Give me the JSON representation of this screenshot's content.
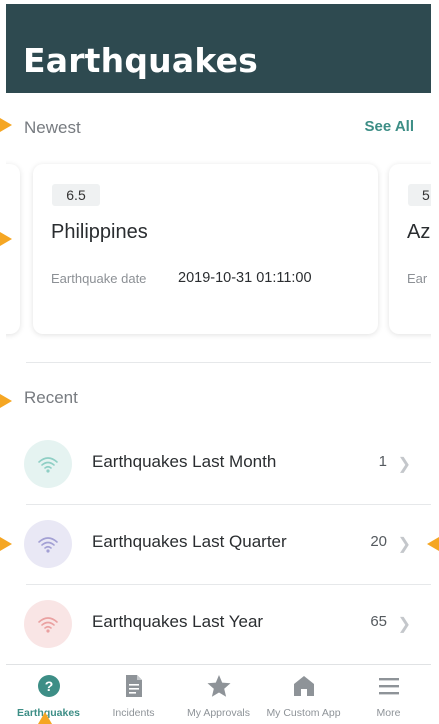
{
  "header": {
    "title": "Earthquakes"
  },
  "newest": {
    "label": "Newest",
    "see_all": "See All",
    "cards": [
      {
        "magnitude": "6.5",
        "place": "Philippines",
        "date_label": "Earthquake date",
        "date_value": "2019-10-31 01:11:00"
      },
      {
        "magnitude": "5",
        "place": "Az",
        "date_label": "Ear",
        "date_value": ""
      }
    ]
  },
  "recent": {
    "label": "Recent",
    "items": [
      {
        "label": "Earthquakes Last Month",
        "count": "1",
        "icon": "signal-icon",
        "color": "#e5f3f1",
        "icon_color": "#8fcfc5"
      },
      {
        "label": "Earthquakes Last Quarter",
        "count": "20",
        "icon": "signal-icon",
        "color": "#e9e8f5",
        "icon_color": "#a3a0d4"
      },
      {
        "label": "Earthquakes Last Year",
        "count": "65",
        "icon": "signal-icon",
        "color": "#f9e5e5",
        "icon_color": "#eaa1a1"
      }
    ]
  },
  "tabs": [
    {
      "label": "Earthquakes",
      "icon": "help-circle-icon",
      "active": true
    },
    {
      "label": "Incidents",
      "icon": "document-icon",
      "active": false
    },
    {
      "label": "My Approvals",
      "icon": "star-icon",
      "active": false
    },
    {
      "label": "My Custom App",
      "icon": "home-icon",
      "active": false
    },
    {
      "label": "More",
      "icon": "menu-icon",
      "active": false
    }
  ],
  "colors": {
    "header_bg": "#2e4a50",
    "accent": "#3d8e86",
    "callout_arrow": "#f5a623"
  }
}
